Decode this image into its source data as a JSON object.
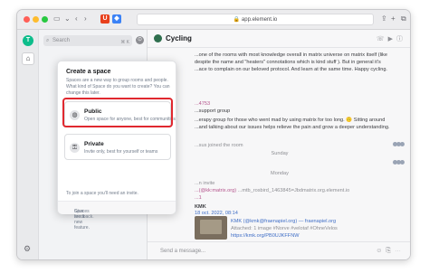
{
  "browser": {
    "url": "app.element.io"
  },
  "sidebar": {
    "avatar_letter": "T",
    "search_placeholder": "Search",
    "search_shortcut": "⌘ K"
  },
  "room": {
    "name": "Cycling",
    "lines": [
      "...one of the rooms with most knowledge overall in matrix universe on matrix itself (like",
      "despite the name and \"heaters\" connotations which is kind stuff ). But in general it's",
      "...ace to complain on our beloved protocol. And learn at the same time. Happy cycling."
    ],
    "sender_fragment": "...4753",
    "support_line": "...support group",
    "therapy_line": "...erapy group for those who went mad by using matrix for too long. 🙃 Sitting around",
    "talking_line": "...and talking about our issues helps relieve the pain and grow a deeper understanding.",
    "joined_line": "...sus joined the room",
    "day_1": "Sunday",
    "day_2": "Monday",
    "invite_line": "...n invite",
    "invite_link": "...(@kk:matrix.org)",
    "invite_extra": "...mtb_rosbird_1463845=Jbdmatrix.org.element.io",
    "sender_2": "...1",
    "kmk_label": "KMK",
    "kmk_date": "18 oct. 2022, 08:14",
    "kmk_author": "KMK (@kmk@fraenapiel.org) — fraenapiel.org",
    "kmk_line1": "Attached: 1 image #Norve #velotaf #OhneVelos",
    "kmk_line2": "https://kmk.org/PB0UJKFFNW"
  },
  "dialog": {
    "title": "Create a space",
    "description": "Spaces are a new way to group rooms and people. What kind of Space do you want to create? You can change this later.",
    "public_title": "Public",
    "public_sub": "Open space for anyone, best for communities",
    "private_title": "Private",
    "private_sub": "Invite only, best for yourself or teams",
    "join_text": "To join a space you'll need an invite.",
    "footer_text": "Spaces are a new feature.",
    "footer_link": "Give feedback."
  },
  "composer": {
    "placeholder": "Send a message..."
  },
  "colors": {
    "accent_green": "#0dbd8b",
    "highlight_red": "#e0282f",
    "link_blue": "#3f6ec6"
  }
}
